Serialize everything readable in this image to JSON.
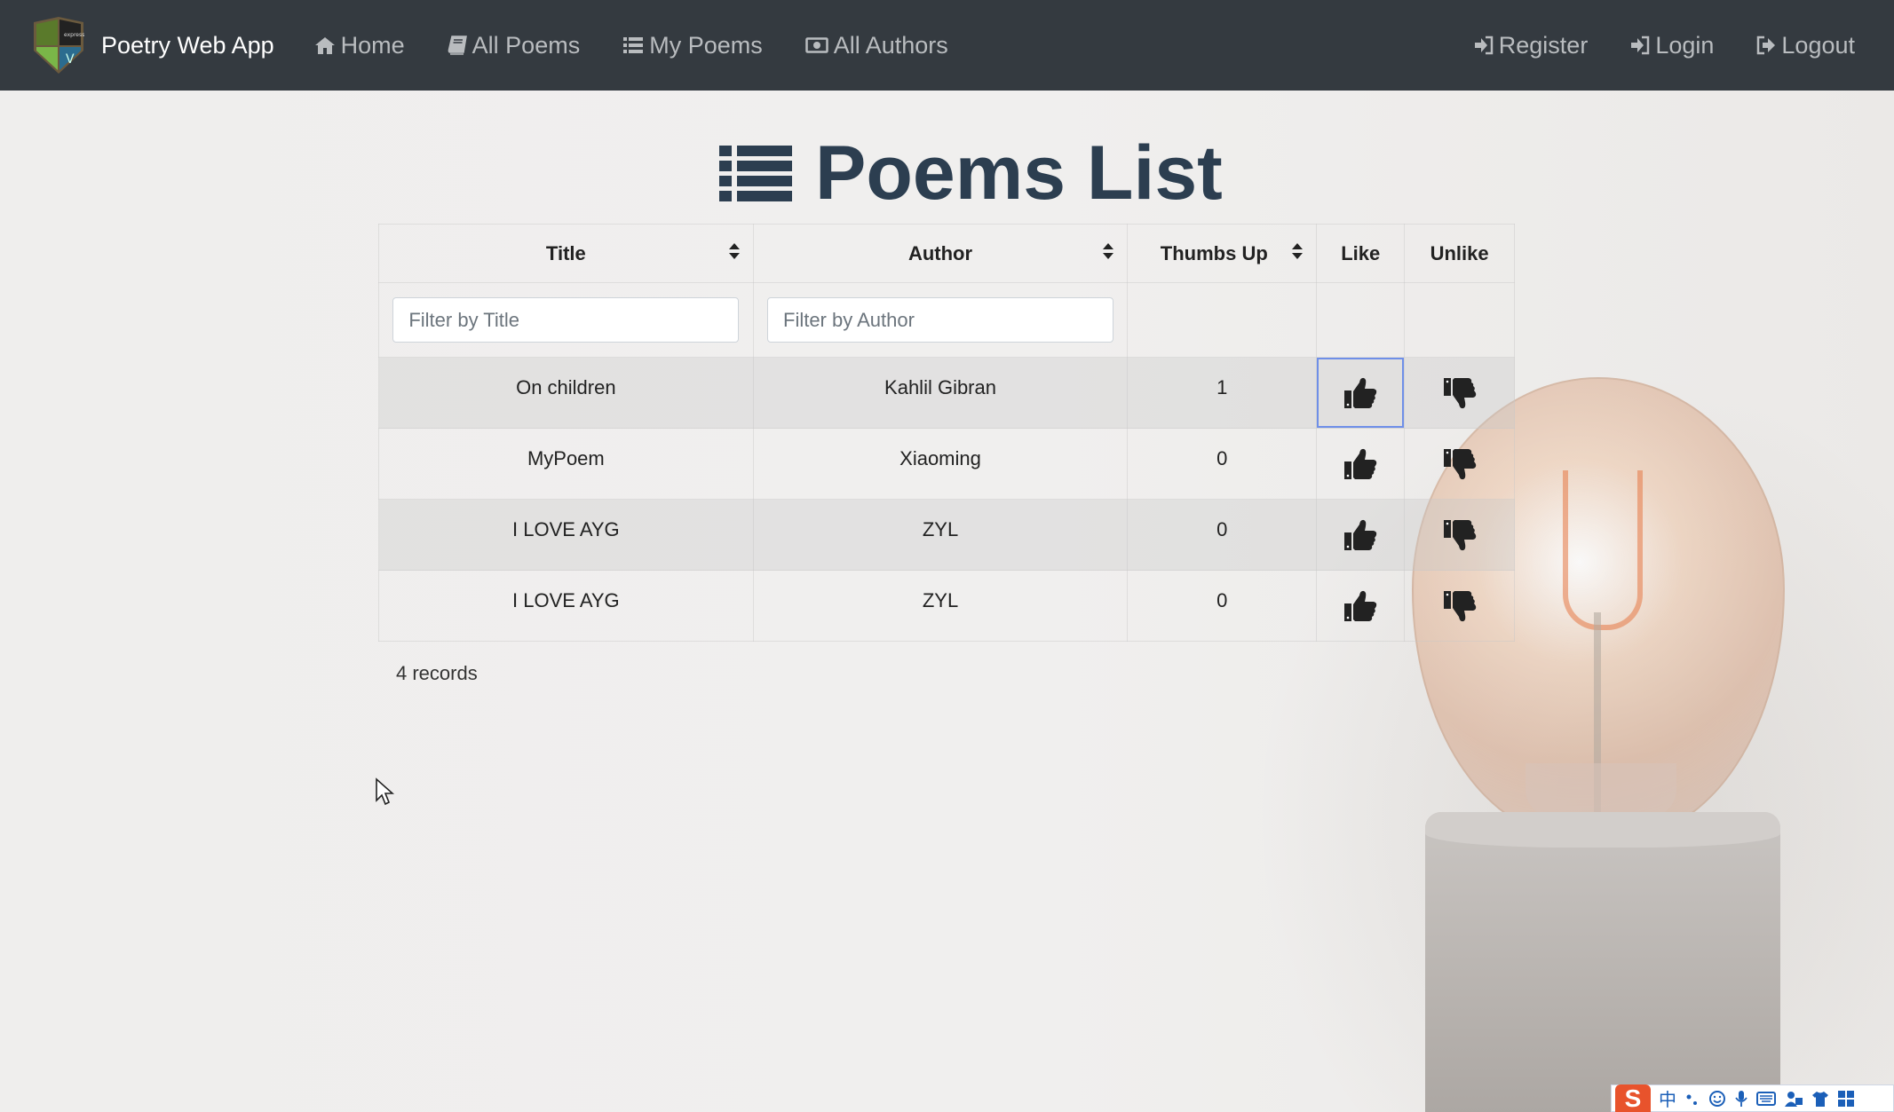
{
  "navbar": {
    "brand": "Poetry Web App",
    "left_links": [
      {
        "label": "Home",
        "icon": "home-icon"
      },
      {
        "label": "All Poems",
        "icon": "book-icon"
      },
      {
        "label": "My Poems",
        "icon": "list-icon"
      },
      {
        "label": "All Authors",
        "icon": "money-bill-icon"
      }
    ],
    "right_links": [
      {
        "label": "Register",
        "icon": "sign-in-icon"
      },
      {
        "label": "Login",
        "icon": "sign-in-icon"
      },
      {
        "label": "Logout",
        "icon": "sign-out-icon"
      }
    ]
  },
  "page": {
    "title": "Poems List"
  },
  "table": {
    "headers": {
      "title": "Title",
      "author": "Author",
      "thumbs_up": "Thumbs Up",
      "like": "Like",
      "unlike": "Unlike"
    },
    "filters": {
      "title_placeholder": "Filter by Title",
      "author_placeholder": "Filter by Author"
    },
    "rows": [
      {
        "title": "On children",
        "author": "Kahlil Gibran",
        "thumbs_up": "1"
      },
      {
        "title": "MyPoem",
        "author": "Xiaoming",
        "thumbs_up": "0"
      },
      {
        "title": "I LOVE AYG",
        "author": "ZYL",
        "thumbs_up": "0"
      },
      {
        "title": "I LOVE AYG",
        "author": "ZYL",
        "thumbs_up": "0"
      }
    ],
    "records": "4 records"
  },
  "ime": {
    "logo": "S",
    "mode": "中"
  },
  "colors": {
    "navbar_bg": "#343a40",
    "title_color": "#2c3e50",
    "focus_border": "#6f8fe8"
  }
}
